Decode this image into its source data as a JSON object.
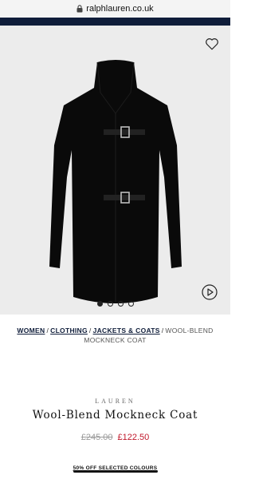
{
  "browser": {
    "url": "ralphlauren.co.uk"
  },
  "colors": {
    "nav": "#0f1d3a",
    "sale_price": "#c0182b",
    "gallery_bg": "#ececec"
  },
  "gallery": {
    "wishlist_icon": "heart-icon",
    "video_icon": "play-icon",
    "image_count": 4,
    "active_index": 0
  },
  "breadcrumb": {
    "items": [
      "WOMEN",
      "CLOTHING",
      "JACKETS & COATS"
    ],
    "current": "WOOL-BLEND MOCKNECK COAT",
    "separator": "/"
  },
  "product": {
    "brand": "LAUREN",
    "title": "Wool-Blend Mockneck Coat",
    "original_price": "£245.00",
    "sale_price": "£122.50"
  },
  "promo": {
    "text": "50% OFF SELECTED COLOURS"
  }
}
